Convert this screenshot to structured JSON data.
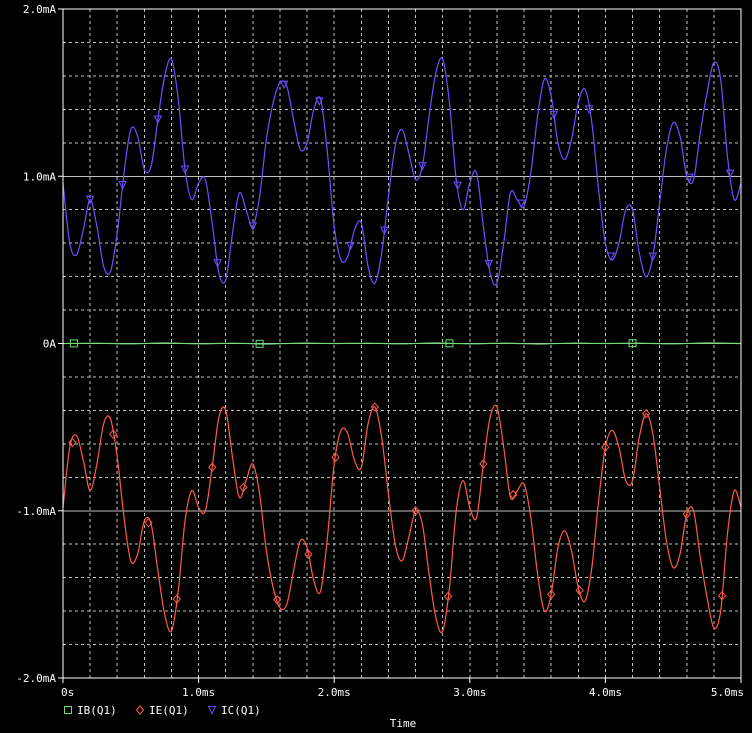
{
  "chart_data": {
    "type": "line",
    "title": "",
    "xlabel": "Time",
    "ylabel": "",
    "xlim": [
      0,
      5.0
    ],
    "ylim": [
      -2.0,
      2.0
    ],
    "x_unit": "ms",
    "x_ticks": [
      {
        "value": 0,
        "label": "0s"
      },
      {
        "value": 1,
        "label": "1.0ms"
      },
      {
        "value": 2,
        "label": "2.0ms"
      },
      {
        "value": 3,
        "label": "3.0ms"
      },
      {
        "value": 4,
        "label": "4.0ms"
      },
      {
        "value": 5,
        "label": "5.0ms"
      }
    ],
    "y_ticks": [
      {
        "value": 2,
        "label": "2.0mA"
      },
      {
        "value": 1,
        "label": "1.0mA"
      },
      {
        "value": 0,
        "label": "0A"
      },
      {
        "value": -1,
        "label": "-1.0mA"
      },
      {
        "value": -2,
        "label": "-2.0mA"
      }
    ],
    "grid": true,
    "background": "#000000",
    "grid_color": "#bfbfbf",
    "legend_position": "bottom-left",
    "series": [
      {
        "name": "IB(Q1)",
        "color": "#6fdc6f",
        "marker": "square",
        "x": [
          0,
          0.25,
          0.5,
          0.75,
          1.0,
          1.25,
          1.5,
          1.75,
          2.0,
          2.25,
          2.5,
          2.75,
          3.0,
          3.25,
          3.5,
          3.75,
          4.0,
          4.25,
          4.5,
          4.75,
          5.0
        ],
        "y": [
          0.0,
          0.002,
          -0.002,
          0.003,
          -0.002,
          0.002,
          -0.003,
          0.002,
          0.0,
          0.002,
          -0.002,
          0.003,
          -0.002,
          0.002,
          -0.003,
          0.002,
          0.0,
          0.002,
          -0.002,
          0.003,
          0.0
        ],
        "marker_x": [
          0.08,
          1.45,
          2.85,
          4.2
        ]
      },
      {
        "name": "IE(Q1)",
        "color": "#ff5a4a",
        "marker": "diamond",
        "x": [
          0,
          0.05,
          0.1,
          0.15,
          0.2,
          0.25,
          0.3,
          0.35,
          0.4,
          0.45,
          0.5,
          0.55,
          0.6,
          0.65,
          0.7,
          0.75,
          0.8,
          0.85,
          0.9,
          0.95,
          1.0,
          1.05,
          1.1,
          1.15,
          1.2,
          1.25,
          1.3,
          1.35,
          1.4,
          1.45,
          1.5,
          1.55,
          1.6,
          1.65,
          1.7,
          1.75,
          1.8,
          1.85,
          1.9,
          1.95,
          2.0,
          2.05,
          2.1,
          2.15,
          2.2,
          2.25,
          2.3,
          2.35,
          2.4,
          2.45,
          2.5,
          2.55,
          2.6,
          2.65,
          2.7,
          2.75,
          2.8,
          2.85,
          2.9,
          2.95,
          3.0,
          3.05,
          3.1,
          3.15,
          3.2,
          3.25,
          3.3,
          3.35,
          3.4,
          3.45,
          3.5,
          3.55,
          3.6,
          3.65,
          3.7,
          3.75,
          3.8,
          3.85,
          3.9,
          3.95,
          4.0,
          4.05,
          4.1,
          4.15,
          4.2,
          4.25,
          4.3,
          4.35,
          4.4,
          4.45,
          4.5,
          4.55,
          4.6,
          4.65,
          4.7,
          4.75,
          4.8,
          4.85,
          4.9,
          4.95,
          5.0
        ],
        "y": [
          -0.98,
          -0.62,
          -0.55,
          -0.7,
          -0.88,
          -0.72,
          -0.48,
          -0.45,
          -0.68,
          -1.04,
          -1.3,
          -1.26,
          -1.06,
          -1.08,
          -1.36,
          -1.62,
          -1.72,
          -1.48,
          -1.06,
          -0.88,
          -0.98,
          -1.0,
          -0.74,
          -0.44,
          -0.4,
          -0.68,
          -0.92,
          -0.82,
          -0.72,
          -0.9,
          -1.24,
          -1.46,
          -1.58,
          -1.56,
          -1.36,
          -1.18,
          -1.22,
          -1.42,
          -1.48,
          -1.16,
          -0.72,
          -0.52,
          -0.54,
          -0.7,
          -0.74,
          -0.48,
          -0.38,
          -0.56,
          -0.9,
          -1.2,
          -1.3,
          -1.16,
          -1.0,
          -1.08,
          -1.38,
          -1.64,
          -1.72,
          -1.46,
          -1.0,
          -0.82,
          -0.98,
          -1.04,
          -0.72,
          -0.44,
          -0.38,
          -0.62,
          -0.92,
          -0.88,
          -0.84,
          -1.04,
          -1.38,
          -1.6,
          -1.5,
          -1.22,
          -1.12,
          -1.24,
          -1.46,
          -1.54,
          -1.34,
          -0.94,
          -0.62,
          -0.52,
          -0.62,
          -0.82,
          -0.82,
          -0.56,
          -0.42,
          -0.54,
          -0.86,
          -1.18,
          -1.34,
          -1.26,
          -1.02,
          -1.0,
          -1.28,
          -1.52,
          -1.7,
          -1.6,
          -1.14,
          -0.88,
          -0.98
        ],
        "marker_x": [
          0.07,
          0.37,
          0.63,
          0.84,
          1.1,
          1.33,
          1.58,
          1.81,
          2.01,
          2.3,
          2.6,
          2.84,
          3.1,
          3.32,
          3.6,
          3.81,
          4.0,
          4.3,
          4.6,
          4.86
        ]
      },
      {
        "name": "IC(Q1)",
        "color": "#6a50ff",
        "marker": "triangle-down",
        "x": [
          0,
          0.05,
          0.1,
          0.15,
          0.2,
          0.25,
          0.3,
          0.35,
          0.4,
          0.45,
          0.5,
          0.55,
          0.6,
          0.65,
          0.7,
          0.75,
          0.8,
          0.85,
          0.9,
          0.95,
          1.0,
          1.05,
          1.1,
          1.15,
          1.2,
          1.25,
          1.3,
          1.35,
          1.4,
          1.45,
          1.5,
          1.55,
          1.6,
          1.65,
          1.7,
          1.75,
          1.8,
          1.85,
          1.9,
          1.95,
          2.0,
          2.05,
          2.1,
          2.15,
          2.2,
          2.25,
          2.3,
          2.35,
          2.4,
          2.45,
          2.5,
          2.55,
          2.6,
          2.65,
          2.7,
          2.75,
          2.8,
          2.85,
          2.9,
          2.95,
          3.0,
          3.05,
          3.1,
          3.15,
          3.2,
          3.25,
          3.3,
          3.35,
          3.4,
          3.45,
          3.5,
          3.55,
          3.6,
          3.65,
          3.7,
          3.75,
          3.8,
          3.85,
          3.9,
          3.95,
          4.0,
          4.05,
          4.1,
          4.15,
          4.2,
          4.25,
          4.3,
          4.35,
          4.4,
          4.45,
          4.5,
          4.55,
          4.6,
          4.65,
          4.7,
          4.75,
          4.8,
          4.85,
          4.9,
          4.95,
          5.0
        ],
        "y": [
          0.96,
          0.6,
          0.53,
          0.68,
          0.86,
          0.7,
          0.46,
          0.43,
          0.66,
          1.02,
          1.28,
          1.24,
          1.04,
          1.06,
          1.34,
          1.6,
          1.7,
          1.46,
          1.04,
          0.86,
          0.96,
          0.98,
          0.72,
          0.42,
          0.38,
          0.66,
          0.9,
          0.8,
          0.7,
          0.88,
          1.22,
          1.44,
          1.56,
          1.54,
          1.34,
          1.16,
          1.2,
          1.4,
          1.46,
          1.14,
          0.7,
          0.5,
          0.52,
          0.68,
          0.72,
          0.46,
          0.36,
          0.54,
          0.88,
          1.18,
          1.28,
          1.14,
          0.98,
          1.06,
          1.36,
          1.62,
          1.7,
          1.44,
          0.98,
          0.8,
          0.96,
          1.02,
          0.7,
          0.42,
          0.36,
          0.6,
          0.9,
          0.86,
          0.82,
          1.02,
          1.36,
          1.58,
          1.48,
          1.2,
          1.1,
          1.22,
          1.44,
          1.52,
          1.32,
          0.92,
          0.6,
          0.5,
          0.6,
          0.8,
          0.8,
          0.54,
          0.4,
          0.52,
          0.84,
          1.16,
          1.32,
          1.24,
          1.0,
          0.98,
          1.26,
          1.5,
          1.68,
          1.58,
          1.12,
          0.86,
          0.96
        ],
        "marker_x": [
          0.2,
          0.44,
          0.7,
          0.9,
          1.14,
          1.4,
          1.63,
          1.89,
          2.12,
          2.37,
          2.65,
          2.91,
          3.14,
          3.38,
          3.62,
          3.88,
          4.04,
          4.35,
          4.62,
          4.92
        ]
      }
    ]
  }
}
